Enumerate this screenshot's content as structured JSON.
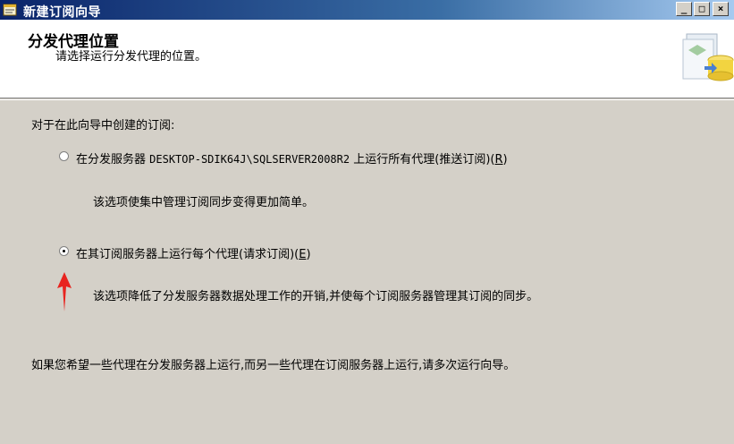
{
  "window": {
    "title": "新建订阅向导",
    "minimize_glyph": "_",
    "maximize_glyph": "□",
    "close_glyph": "×"
  },
  "header": {
    "title": "分发代理位置",
    "subtitle": "请选择运行分发代理的位置。",
    "graphic_icon": "database-wizard-icon"
  },
  "body": {
    "intro": "对于在此向导中创建的订阅:",
    "option_push": {
      "label_prefix": "在分发服务器 ",
      "server_name": "DESKTOP-SDIK64J\\SQLSERVER2008R2",
      "label_suffix": " 上运行所有代理(推送订阅)(",
      "mnemonic": "R",
      "label_end": ")",
      "selected": false,
      "description": "该选项使集中管理订阅同步变得更加简单。"
    },
    "option_pull": {
      "label_prefix": "在其订阅服务器上运行每个代理(请求订阅)(",
      "mnemonic": "E",
      "label_end": ")",
      "selected": true,
      "description": "该选项降低了分发服务器数据处理工作的开销,并使每个订阅服务器管理其订阅的同步。"
    },
    "footer_note": "如果您希望一些代理在分发服务器上运行,而另一些代理在订阅服务器上运行,请多次运行向导。"
  },
  "colors": {
    "titlebar_start": "#0a246a",
    "window_bg": "#d4d0c8",
    "annotation_arrow": "#e8241f"
  }
}
